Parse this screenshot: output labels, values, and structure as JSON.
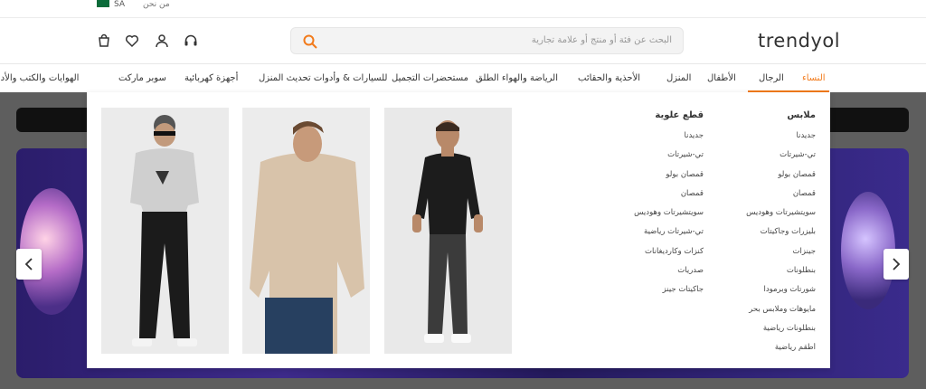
{
  "topbar": {
    "locale": "SA",
    "about": "من نحن"
  },
  "header": {
    "logo": "trendyol",
    "search_placeholder": "البحث عن فئة أو منتج أو علامة تجارية"
  },
  "nav": {
    "items": [
      {
        "label": "النساء",
        "active": true
      },
      {
        "label": "الرجال"
      },
      {
        "label": "الأطفال"
      },
      {
        "label": "المنزل"
      },
      {
        "label": "الأحذية والحقائب"
      },
      {
        "label": "الرياضة والهواء الطلق"
      },
      {
        "label": "مستحضرات التجميل"
      },
      {
        "label": "للسيارات & وأدوات تحديث المنزل"
      },
      {
        "label": "أجهزة كهربائية"
      },
      {
        "label": "سوبر ماركت"
      },
      {
        "label": "الهوايات والكتب والأدوات الم"
      }
    ]
  },
  "mega_menu": {
    "clothing": {
      "title": "ملابس",
      "links": [
        "جديدنا",
        "تي-شيرتات",
        "قمصان بولو",
        "قمصان",
        "سويتشيرتات وهوديس",
        "بليزرات وجاكيتات",
        "جينزات",
        "بنطلونات",
        "شورتات وبرمودا",
        "مايوهات وملابس بحر",
        "بنطلونات رياضية",
        "أطقم رياضية"
      ]
    },
    "tops": {
      "title": "قطع علوية",
      "links": [
        "جديدنا",
        "تي-شيرتات",
        "قمصان بولو",
        "قمصان",
        "سويتشيرتات وهوديس",
        "تي-شيرتات رياضية",
        "كنزات وكارديغانات",
        "صدريات",
        "جاكيتات جينز"
      ]
    }
  }
}
